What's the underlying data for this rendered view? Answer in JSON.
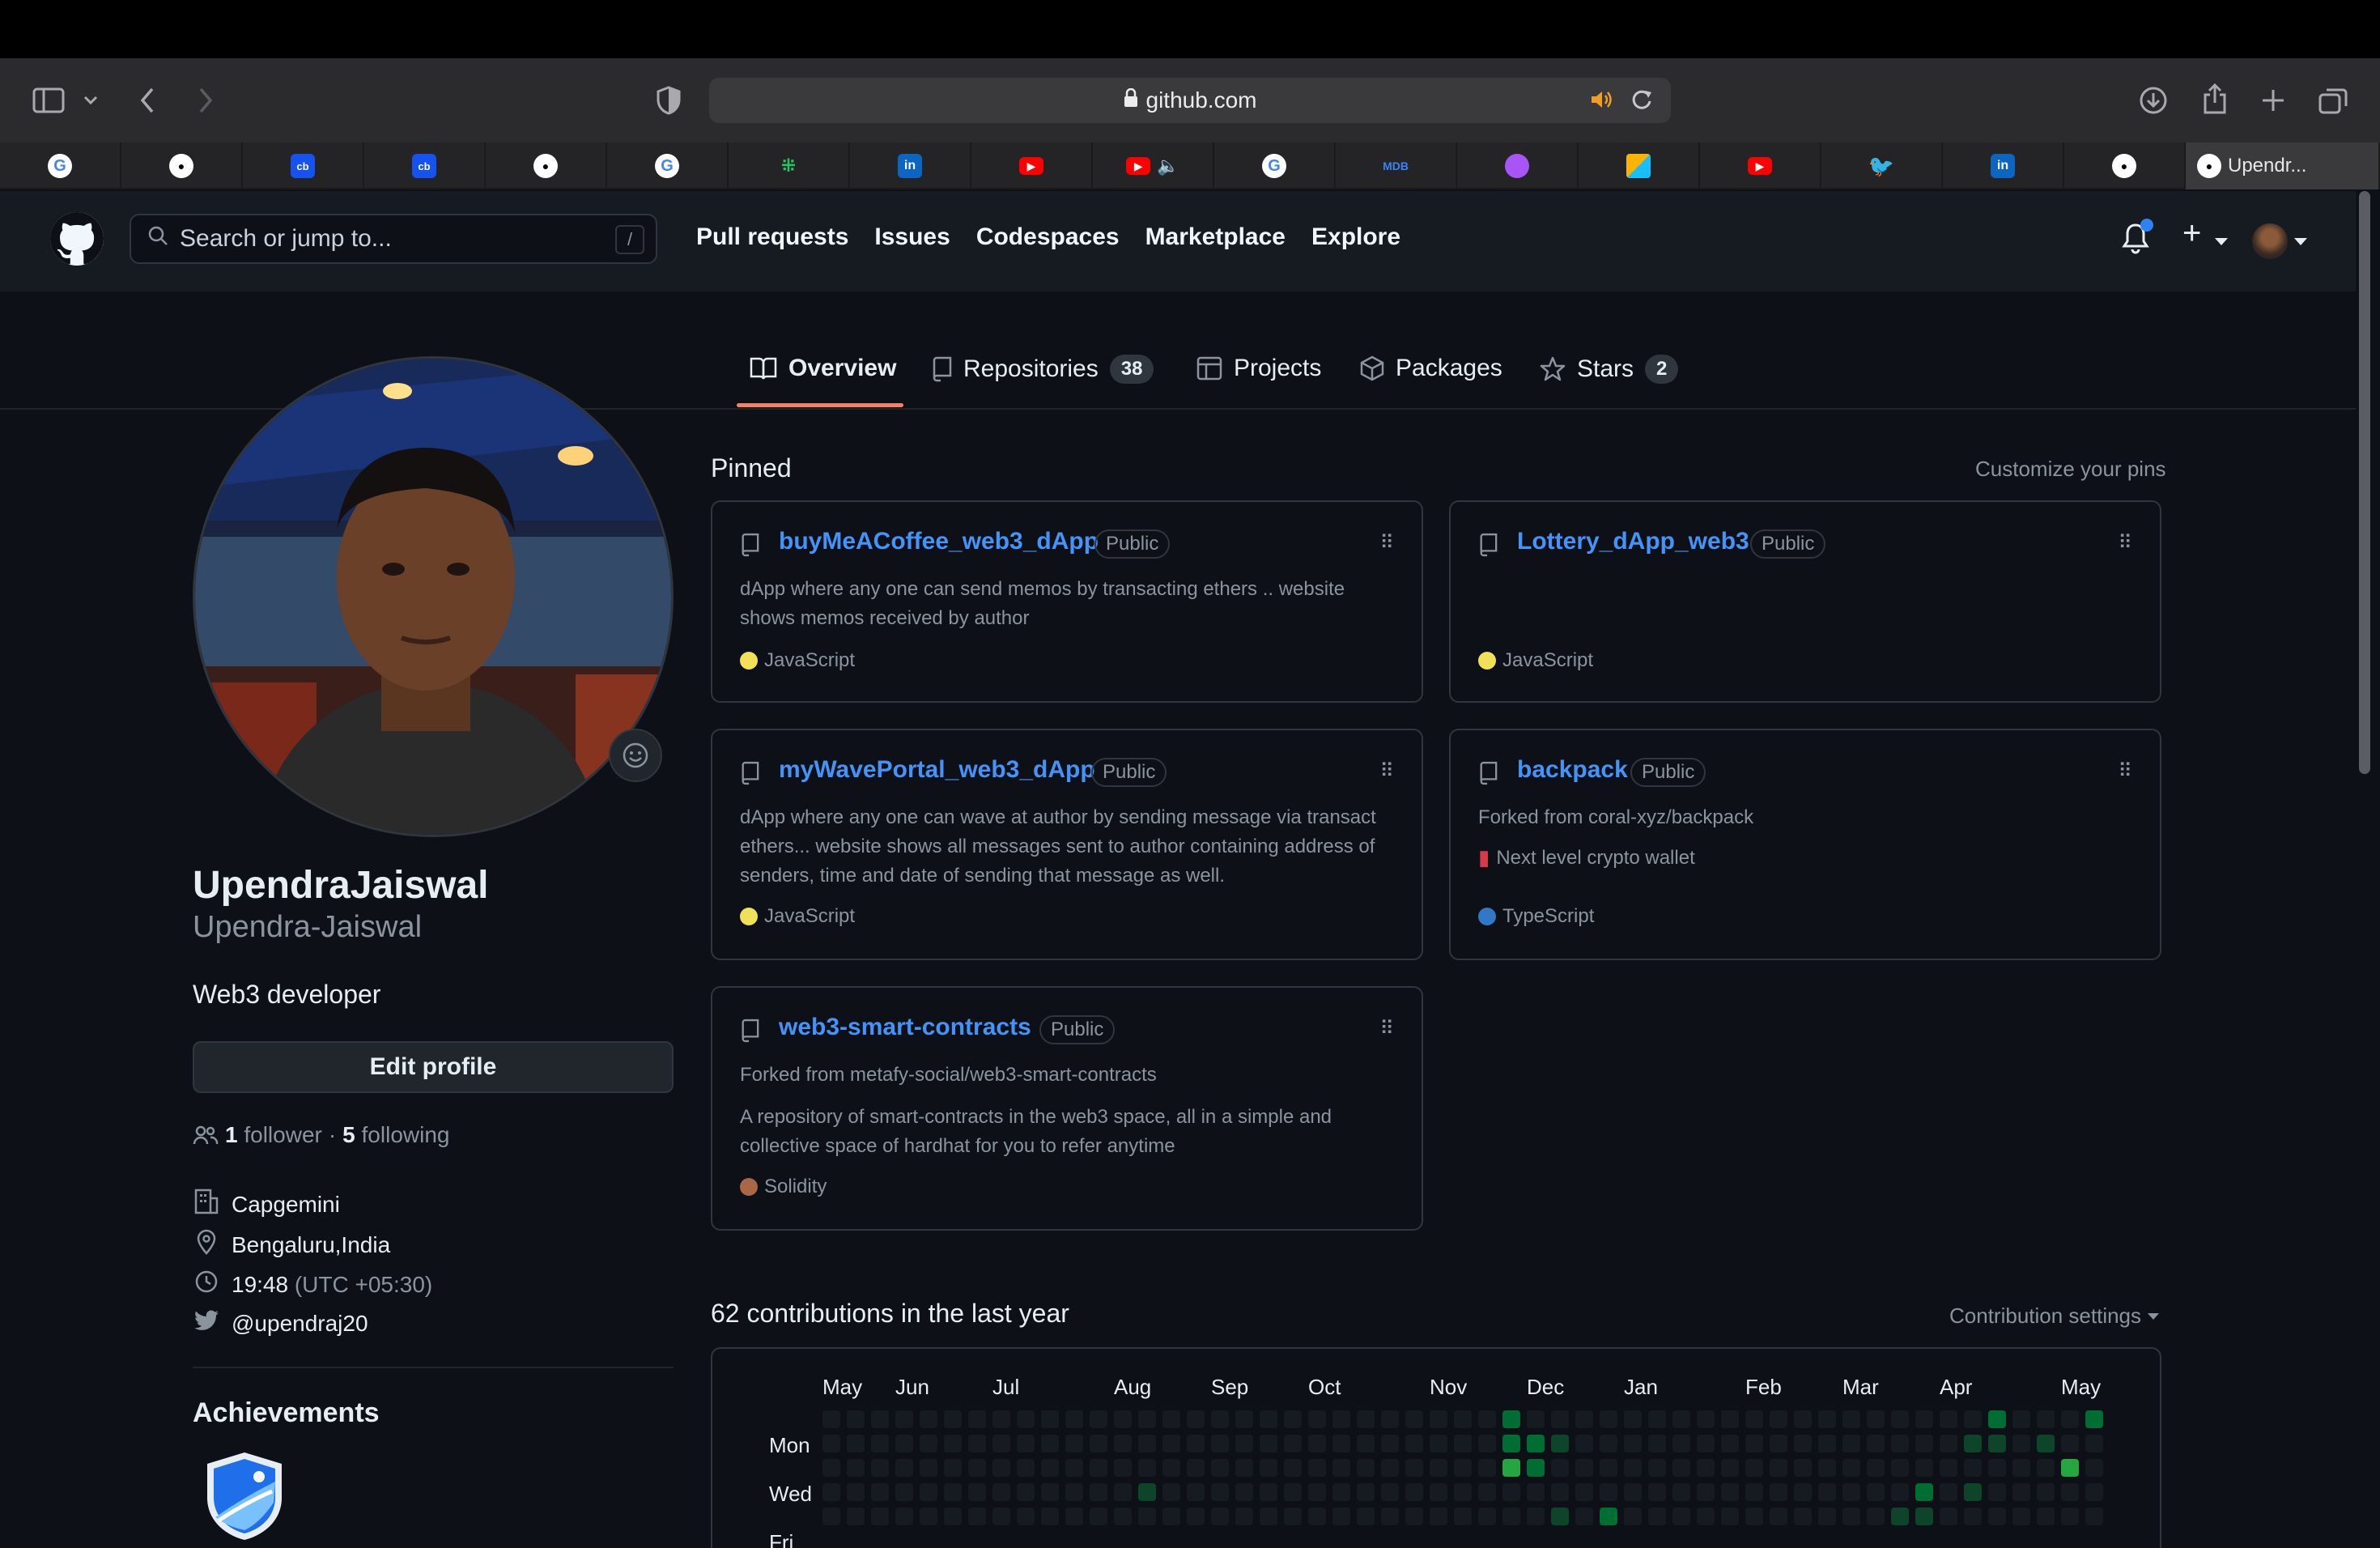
{
  "browser": {
    "url": "github.com",
    "active_tab_label": "Upendr..."
  },
  "tabs": [
    {
      "icon": "google-icon"
    },
    {
      "icon": "github-icon"
    },
    {
      "icon": "coinbase-icon",
      "text": "cb"
    },
    {
      "icon": "coinbase-icon",
      "text": "cb"
    },
    {
      "icon": "github-icon"
    },
    {
      "icon": "google-icon"
    },
    {
      "icon": "dots-icon"
    },
    {
      "icon": "linkedin-icon",
      "text": "in"
    },
    {
      "icon": "youtube-icon"
    },
    {
      "icon": "youtube-icon"
    },
    {
      "icon": "google-icon"
    },
    {
      "icon": "mdb-icon",
      "text": "MDB"
    },
    {
      "icon": "orb-icon"
    },
    {
      "icon": "airtable-icon"
    },
    {
      "icon": "youtube-icon"
    },
    {
      "icon": "twitter-icon"
    },
    {
      "icon": "linkedin-icon",
      "text": "in"
    },
    {
      "icon": "github-icon"
    }
  ],
  "header": {
    "search_placeholder": "Search or jump to...",
    "search_shortcut": "/",
    "nav": [
      "Pull requests",
      "Issues",
      "Codespaces",
      "Marketplace",
      "Explore"
    ],
    "plus": "+"
  },
  "profile_tabs": {
    "overview": "Overview",
    "repositories": "Repositories",
    "repositories_count": "38",
    "projects": "Projects",
    "packages": "Packages",
    "stars": "Stars",
    "stars_count": "2"
  },
  "profile": {
    "display_name": "UpendraJaiswal",
    "username": "Upendra-Jaiswal",
    "bio": "Web3 developer",
    "edit_profile": "Edit profile",
    "followers": "1",
    "followers_label": "follower",
    "dot": "·",
    "following": "5",
    "following_label": "following",
    "company": "Capgemini",
    "location": "Bengaluru,India",
    "time": "19:48",
    "timezone": "(UTC +05:30)",
    "twitter": "@upendraj20",
    "achievements_title": "Achievements"
  },
  "pinned": {
    "title": "Pinned",
    "customize": "Customize your pins",
    "public_label": "Public",
    "repos": [
      {
        "name": "buyMeACoffee_web3_dApp",
        "desc": "dApp where any one can send memos by transacting ethers .. website shows memos received by author",
        "lang": "JavaScript",
        "lang_color": "#f1e05a"
      },
      {
        "name": "Lottery_dApp_web3",
        "desc": "",
        "lang": "JavaScript",
        "lang_color": "#f1e05a"
      },
      {
        "name": "myWavePortal_web3_dApp",
        "desc": "dApp where any one can wave at author by sending message via transact ethers... website shows all messages sent to author containing address of senders, time and date of sending that message as well.",
        "lang": "JavaScript",
        "lang_color": "#f1e05a"
      },
      {
        "name": "backpack",
        "forked": "Forked from coral-xyz/backpack",
        "desc": "Next level crypto wallet",
        "lang": "TypeScript",
        "lang_color": "#3178c6"
      },
      {
        "name": "web3-smart-contracts",
        "forked": "Forked from metafy-social/web3-smart-contracts",
        "desc": "A repository of smart-contracts in the web3 space, all in a simple and collective space of hardhat for you to refer anytime",
        "lang": "Solidity",
        "lang_color": "#aa6746"
      }
    ]
  },
  "contributions": {
    "title": "62 contributions in the last year",
    "settings": "Contribution settings",
    "months": [
      "May",
      "Jun",
      "Jul",
      "Aug",
      "Sep",
      "Oct",
      "Nov",
      "Dec",
      "Jan",
      "Feb",
      "Mar",
      "Apr",
      "May"
    ],
    "days": [
      "Mon",
      "Wed",
      "Fri"
    ],
    "active_cells": [
      {
        "week": 28,
        "day": 0,
        "level": 2
      },
      {
        "week": 28,
        "day": 1,
        "level": 2
      },
      {
        "week": 28,
        "day": 2,
        "level": 3
      },
      {
        "week": 29,
        "day": 1,
        "level": 2
      },
      {
        "week": 29,
        "day": 2,
        "level": 2
      },
      {
        "week": 30,
        "day": 1,
        "level": 1
      },
      {
        "week": 30,
        "day": 4,
        "level": 1
      },
      {
        "week": 30,
        "day": 5,
        "level": 2
      },
      {
        "week": 29,
        "day": 5,
        "level": 1
      },
      {
        "week": 32,
        "day": 4,
        "level": 2
      },
      {
        "week": 32,
        "day": 5,
        "level": 2
      },
      {
        "week": 13,
        "day": 3,
        "level": 1
      },
      {
        "week": 44,
        "day": 4,
        "level": 1
      },
      {
        "week": 45,
        "day": 3,
        "level": 2
      },
      {
        "week": 45,
        "day": 4,
        "level": 1
      },
      {
        "week": 47,
        "day": 3,
        "level": 1
      },
      {
        "week": 47,
        "day": 1,
        "level": 1
      },
      {
        "week": 48,
        "day": 0,
        "level": 2
      },
      {
        "week": 48,
        "day": 1,
        "level": 1
      },
      {
        "week": 50,
        "day": 1,
        "level": 1
      },
      {
        "week": 51,
        "day": 2,
        "level": 3
      },
      {
        "week": 52,
        "day": 0,
        "level": 2
      }
    ]
  }
}
